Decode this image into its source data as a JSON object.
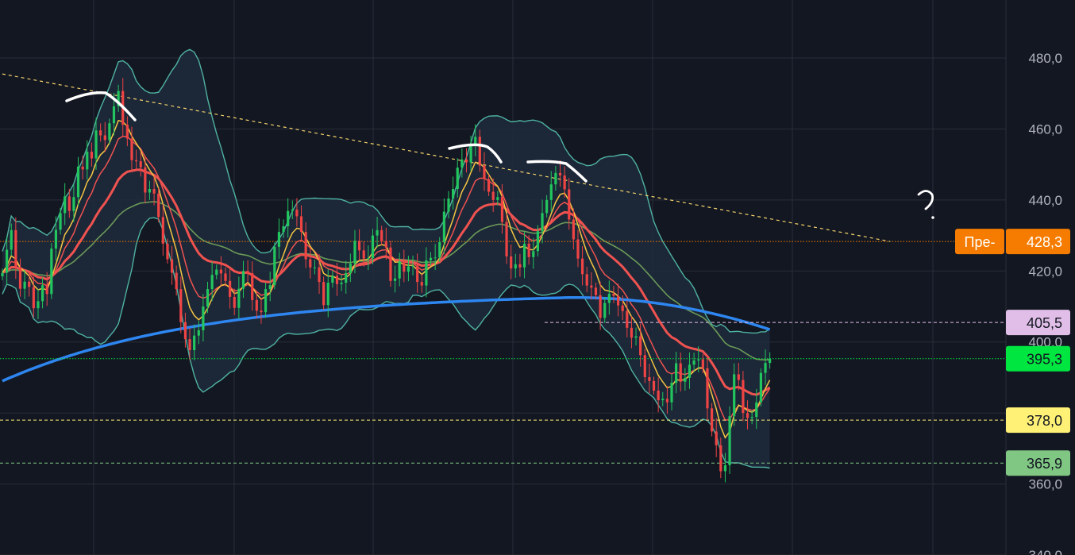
{
  "chart_data": {
    "type": "candlestick",
    "title": "",
    "xlabel": "",
    "ylabel": "",
    "ylim": [
      337.5,
      494
    ],
    "y_ticks": [
      480,
      460,
      440,
      420,
      400,
      380,
      360,
      340
    ],
    "y_tick_labels": [
      "480,0",
      "460,0",
      "440,0",
      "420,0",
      "400,0",
      "380,0",
      "360,0",
      "340,0"
    ],
    "grid": true,
    "colors": {
      "background": "#131722",
      "grid": "#2a2e39",
      "up": "#22c55e",
      "down": "#ef4444",
      "bollinger": "#4fb3a2",
      "sma200": "#2e86f0",
      "ema_red": "#ef5350",
      "ema_yellow": "#f5c542",
      "ma_green": "#6b9a57",
      "resistance": "#f5d46b",
      "drawing": "#ffffff"
    },
    "price_lines": [
      {
        "label": "Пре-",
        "value": "428,3",
        "price": 428.3,
        "color": "#f57c00",
        "style": "dotted"
      },
      {
        "label": "",
        "value": "405,5",
        "price": 405.5,
        "color": "#e1bee7",
        "style": "dashed"
      },
      {
        "label": "",
        "value": "395,3",
        "price": 395.3,
        "color": "#00e640",
        "style": "dotted"
      },
      {
        "label": "",
        "value": "378,0",
        "price": 378.0,
        "color": "#fff176",
        "style": "dashed"
      },
      {
        "label": "",
        "value": "365,9",
        "price": 365.9,
        "color": "#81c784",
        "style": "dashed"
      }
    ],
    "trendline": {
      "from": [
        0,
        475.5
      ],
      "to": [
        199,
        428.3
      ]
    },
    "close": [
      419.5,
      426.0,
      431.5,
      421.0,
      415.0,
      417.0,
      415.5,
      409.5,
      411.5,
      416.0,
      413.5,
      426.3,
      431.6,
      436.3,
      441.0,
      436.9,
      440.8,
      449.4,
      448.6,
      453.6,
      451.7,
      459.6,
      458.2,
      456.9,
      461.6,
      466.4,
      470.7,
      461.2,
      457.3,
      451.2,
      450.9,
      449.2,
      442.1,
      443.1,
      441.8,
      435.2,
      427.7,
      423.3,
      419.5,
      414.9,
      405.6,
      400.8,
      397.7,
      401.8,
      403.3,
      410.0,
      414.9,
      418.9,
      420.4,
      419.3,
      417.2,
      412.7,
      409.6,
      415.0,
      420.0,
      419.4,
      411.8,
      408.8,
      408.4,
      414.9,
      416.0,
      426.8,
      431.0,
      432.6,
      436.9,
      437.3,
      435.4,
      431.0,
      423.3,
      421.0,
      421.0,
      416.9,
      410.4,
      416.7,
      418.6,
      416.3,
      416.7,
      419.4,
      422.1,
      428.5,
      425.8,
      423.5,
      423.6,
      430.0,
      431.5,
      428.4,
      426.6,
      417.2,
      417.9,
      422.7,
      419.8,
      421.3,
      421.5,
      416.9,
      415.9,
      423.0,
      423.7,
      423.8,
      428.1,
      436.7,
      440.4,
      443.1,
      449.1,
      451.4,
      450.6,
      455.5,
      457.8,
      449.7,
      445.9,
      442.3,
      440.0,
      440.8,
      433.8,
      424.1,
      420.7,
      421.9,
      421.0,
      427.7,
      423.9,
      425.6,
      431.2,
      436.3,
      440.0,
      444.4,
      447.6,
      446.9,
      443.0,
      434.5,
      428.9,
      423.5,
      419.1,
      415.9,
      415.3,
      413.2,
      406.8,
      411.0,
      413.6,
      413.0,
      410.3,
      408.7,
      404.0,
      401.2,
      401.6,
      396.3,
      390.1,
      389.0,
      386.3,
      383.6,
      384.0,
      383.0,
      388.5,
      394.0,
      388.8,
      389.9,
      393.6,
      394.8,
      395.1,
      392.6,
      381.3,
      374.8,
      370.9,
      363.6,
      365.3,
      379.1,
      390.9,
      389.3,
      380.0,
      378.6,
      378.9,
      383.0,
      391.3,
      394.1,
      395.3
    ]
  }
}
